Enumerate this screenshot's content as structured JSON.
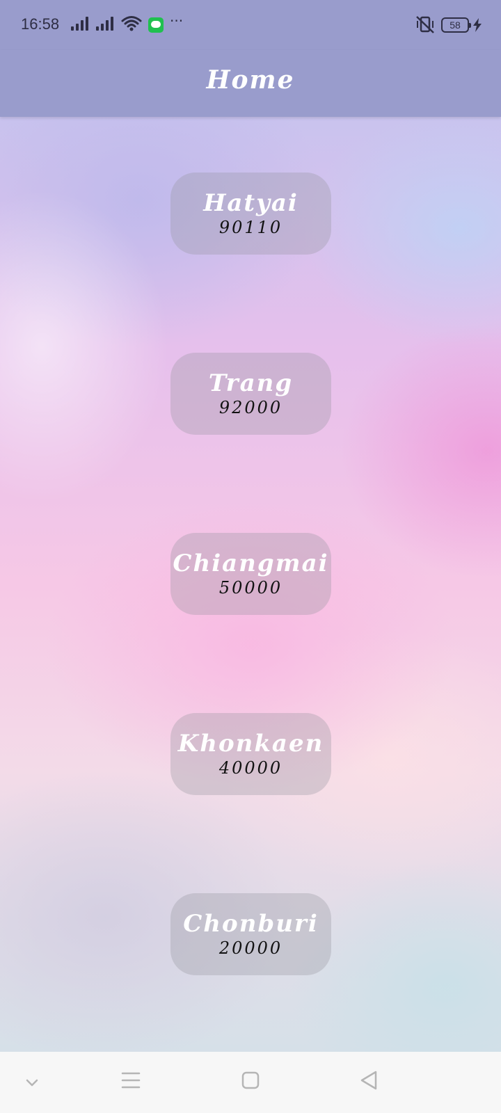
{
  "status_bar": {
    "time": "16:58",
    "battery_level": "58",
    "icons": [
      "signal-icon",
      "signal-icon",
      "wifi-icon",
      "line-app-icon",
      "more-dots-icon",
      "vibrate-off-icon",
      "battery-icon",
      "charging-icon"
    ]
  },
  "app_bar": {
    "title": "Home",
    "background": "#999ccc"
  },
  "cities": [
    {
      "name": "Hatyai",
      "code": "90110"
    },
    {
      "name": "Trang",
      "code": "92000"
    },
    {
      "name": "Chiangmai",
      "code": "50000"
    },
    {
      "name": "Khonkaen",
      "code": "40000"
    },
    {
      "name": "Chonburi",
      "code": "20000"
    }
  ],
  "nav_bar": {
    "buttons": [
      "chevron-down-icon",
      "menu-icon",
      "home-square-icon",
      "back-triangle-icon"
    ]
  }
}
